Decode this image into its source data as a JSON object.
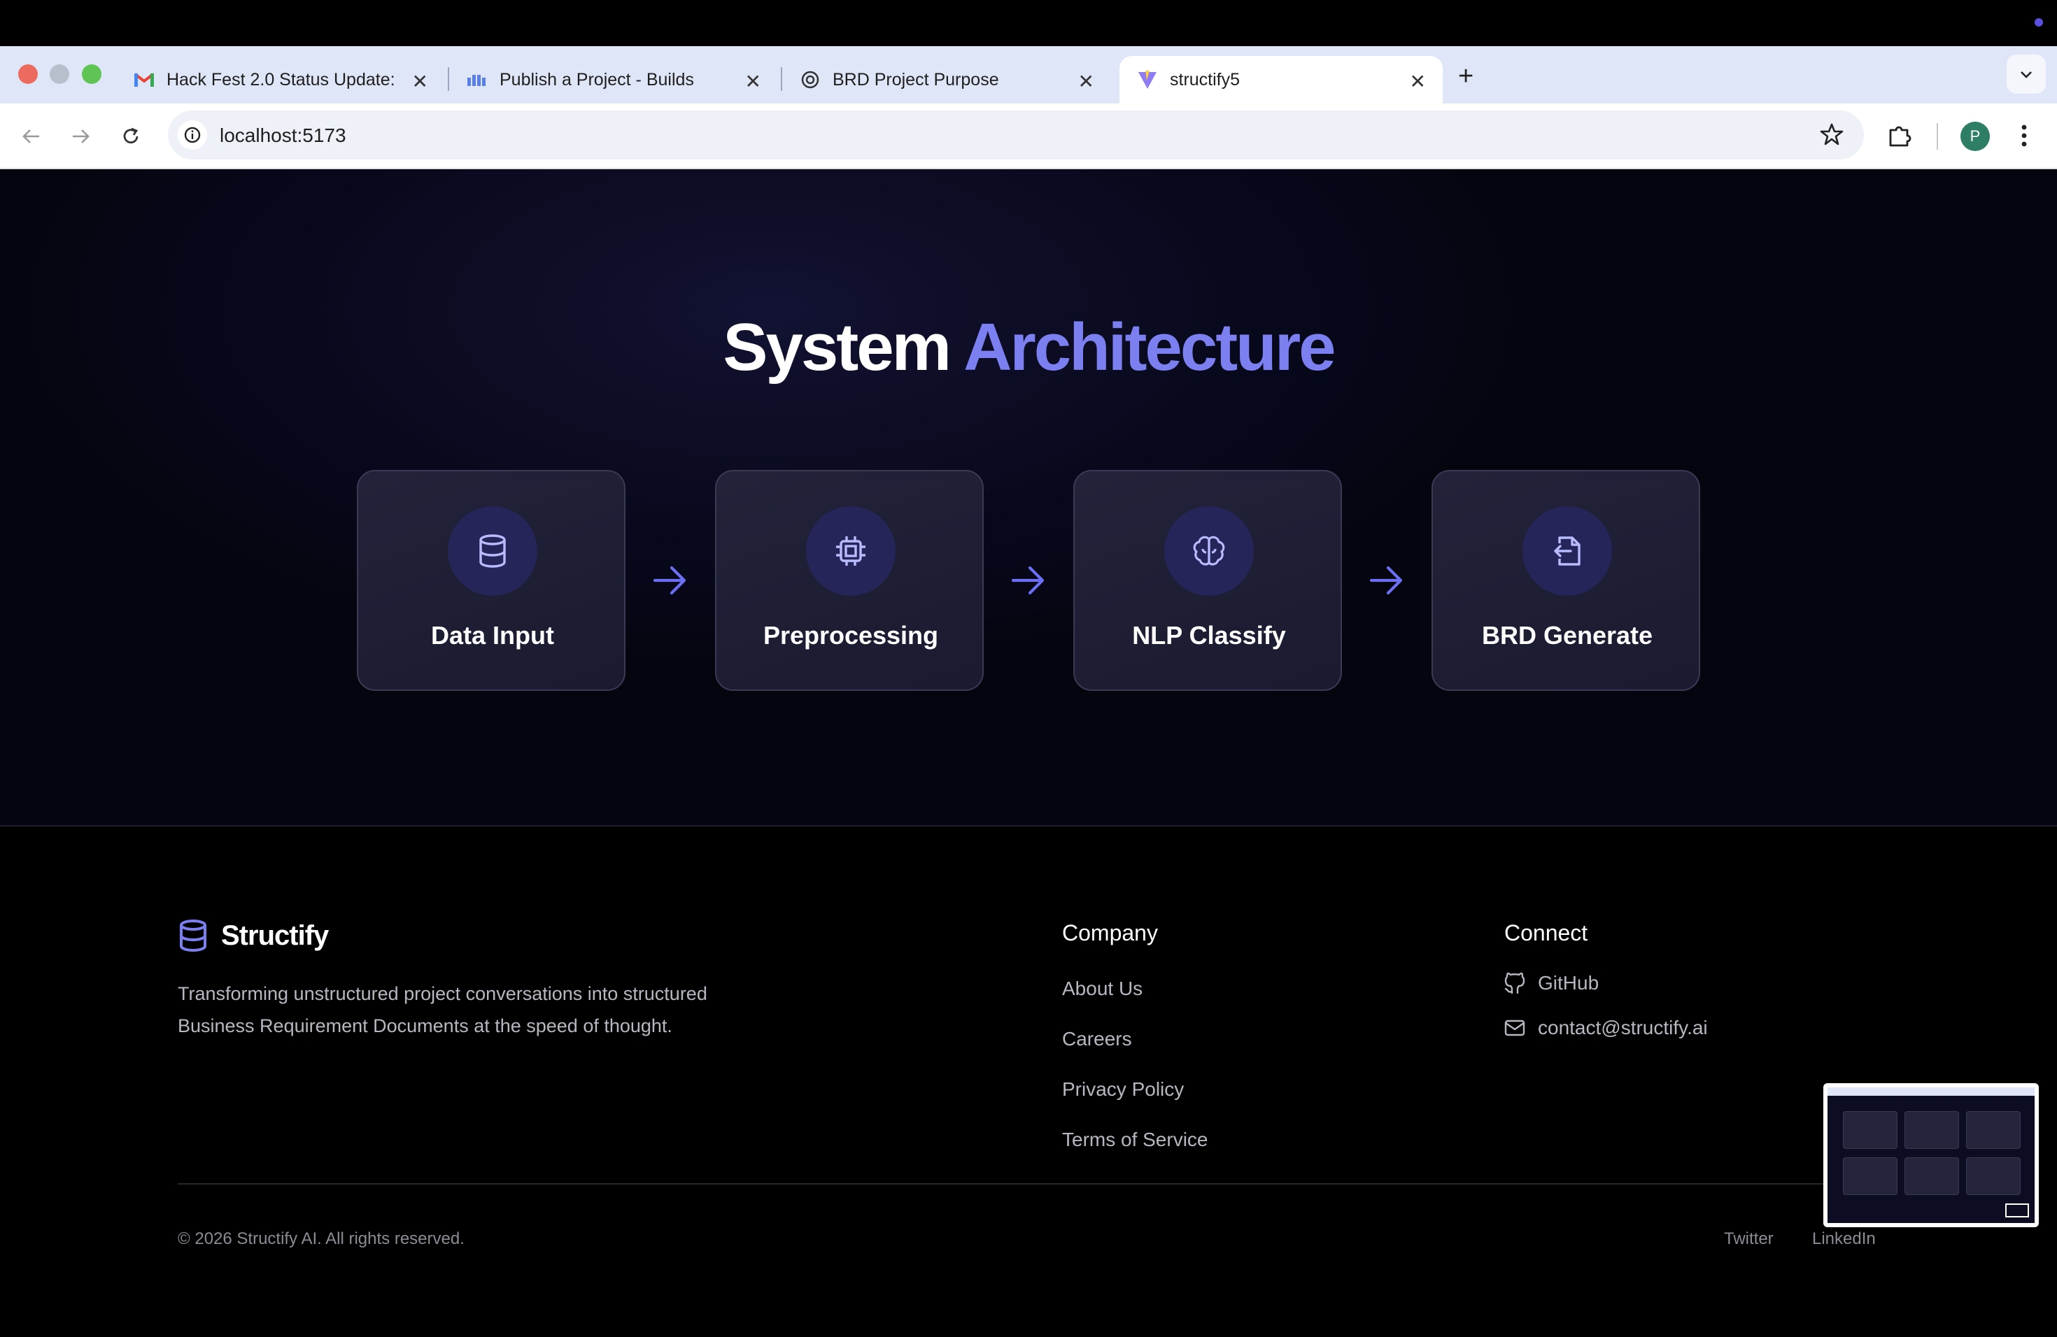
{
  "browser": {
    "tabs": [
      {
        "title": "Hack Fest 2.0 Status Update:",
        "favicon": "gmail-icon"
      },
      {
        "title": "Publish a Project - Builds",
        "favicon": "builds-icon"
      },
      {
        "title": "BRD Project Purpose",
        "favicon": "chatgpt-icon"
      },
      {
        "title": "structify5",
        "favicon": "vite-icon",
        "active": true
      }
    ],
    "new_tab": "+",
    "url": "localhost:5173",
    "profile_initial": "P"
  },
  "hero": {
    "title_plain": "System",
    "title_accent": "Architecture",
    "accent_color": "#7c7ff0",
    "steps": [
      {
        "label": "Data Input",
        "icon": "database-icon"
      },
      {
        "label": "Preprocessing",
        "icon": "cpu-icon"
      },
      {
        "label": "NLP Classify",
        "icon": "brain-icon"
      },
      {
        "label": "BRD Generate",
        "icon": "file-output-icon"
      }
    ]
  },
  "footer": {
    "brand": "Structify",
    "tagline": "Transforming unstructured project conversations into structured Business Requirement Documents at the speed of thought.",
    "company": {
      "title": "Company",
      "links": [
        "About Us",
        "Careers",
        "Privacy Policy",
        "Terms of Service"
      ]
    },
    "connect": {
      "title": "Connect",
      "github": "GitHub",
      "email": "contact@structify.ai"
    },
    "copyright": "© 2026 Structify AI. All rights reserved.",
    "social": [
      "Twitter",
      "LinkedIn"
    ]
  }
}
